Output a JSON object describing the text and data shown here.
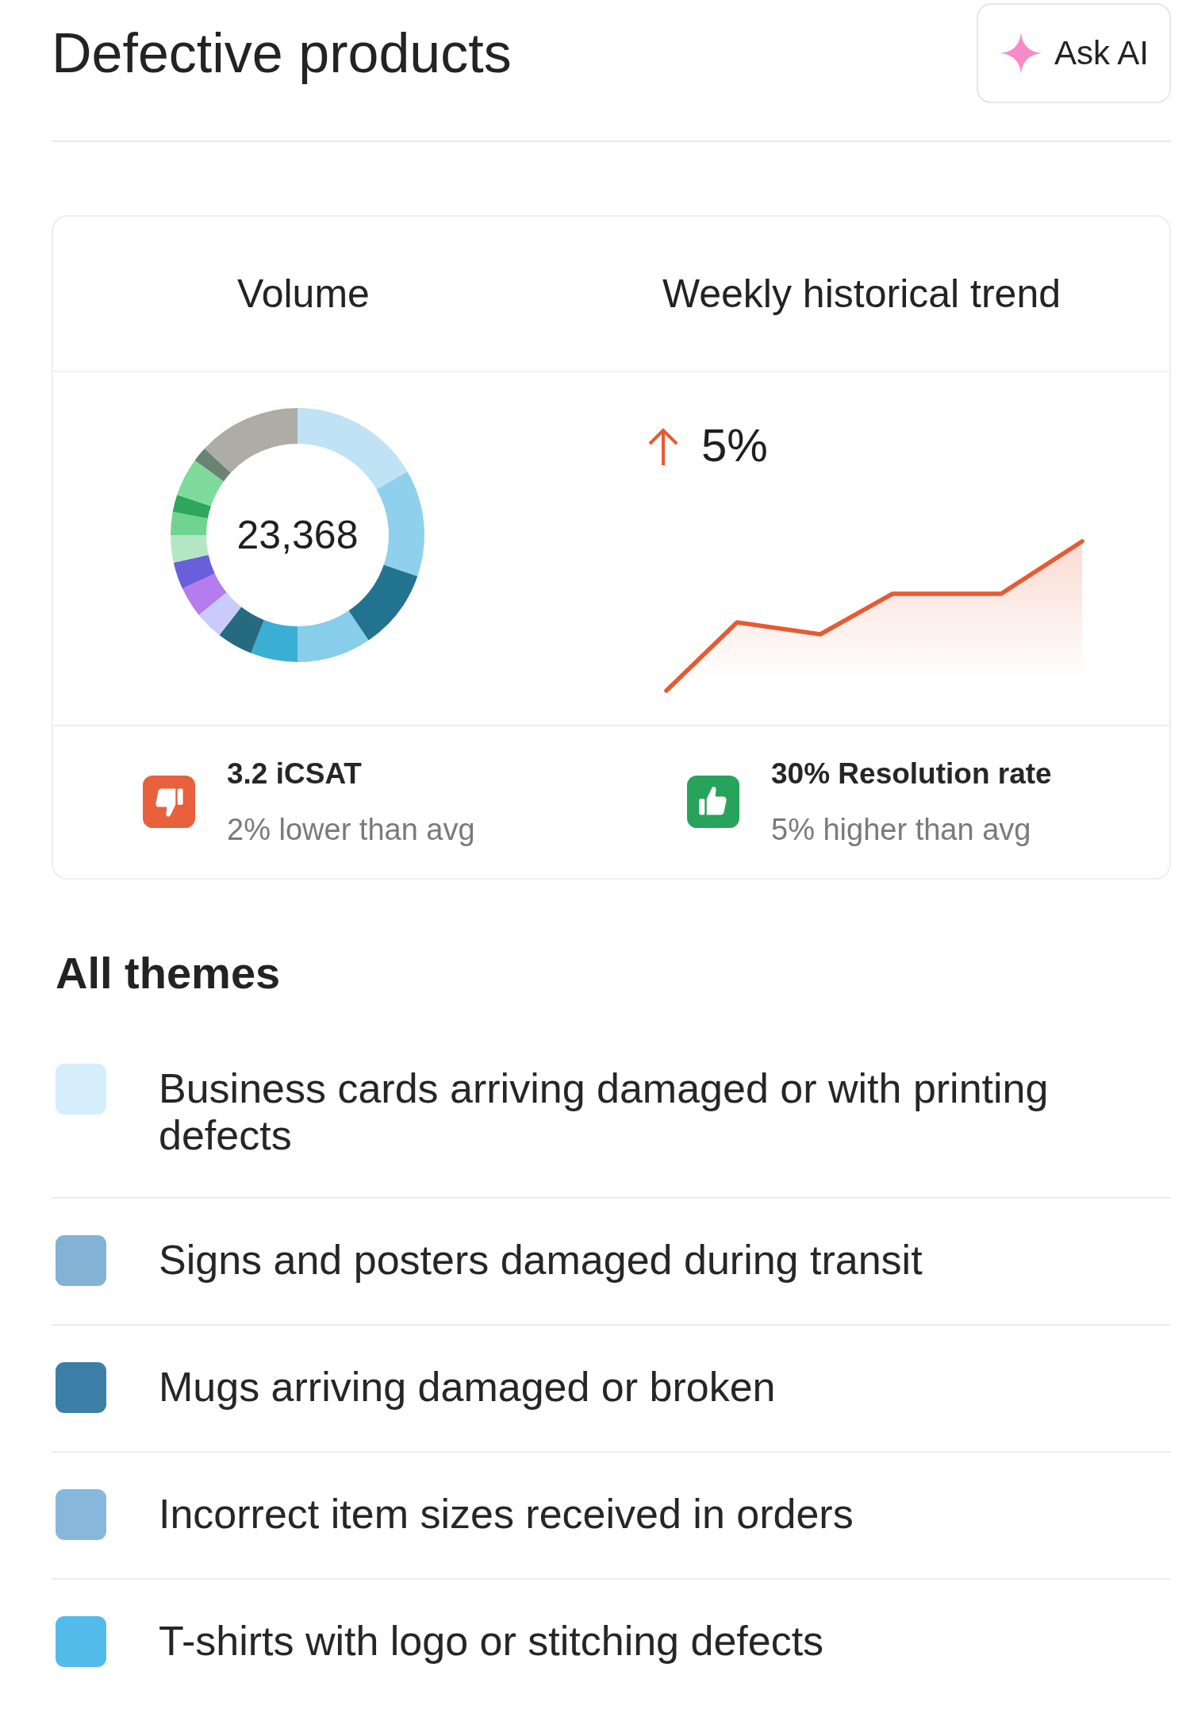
{
  "header": {
    "title": "Defective products",
    "ask_button": {
      "label": "Ask AI"
    }
  },
  "summary": {
    "volume": {
      "heading": "Volume",
      "total": "23,368"
    },
    "trend": {
      "heading": "Weekly historical trend",
      "change": "5%"
    },
    "metrics": [
      {
        "kind": "negative",
        "title": "3.2 iCSAT",
        "note": "2% lower than avg"
      },
      {
        "kind": "positive",
        "title": "30% Resolution rate",
        "note": "5% higher than avg"
      }
    ]
  },
  "themes": {
    "heading": "All themes",
    "items": [
      {
        "label": "Business cards arriving damaged or with printing defects",
        "color": "#d6eefa"
      },
      {
        "label": "Signs and posters damaged during transit",
        "color": "#84b2d4"
      },
      {
        "label": "Mugs arriving damaged or broken",
        "color": "#3d7ea7"
      },
      {
        "label": "Incorrect item sizes received in orders",
        "color": "#87b8dc"
      },
      {
        "label": "T-shirts with logo or stitching defects",
        "color": "#52bbe9"
      }
    ]
  }
}
